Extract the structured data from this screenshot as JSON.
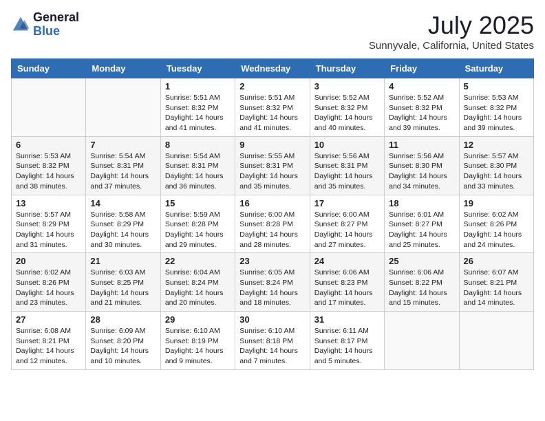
{
  "header": {
    "logo_general": "General",
    "logo_blue": "Blue",
    "month": "July 2025",
    "location": "Sunnyvale, California, United States"
  },
  "weekdays": [
    "Sunday",
    "Monday",
    "Tuesday",
    "Wednesday",
    "Thursday",
    "Friday",
    "Saturday"
  ],
  "weeks": [
    [
      {
        "day": "",
        "info": ""
      },
      {
        "day": "",
        "info": ""
      },
      {
        "day": "1",
        "info": "Sunrise: 5:51 AM\nSunset: 8:32 PM\nDaylight: 14 hours and 41 minutes."
      },
      {
        "day": "2",
        "info": "Sunrise: 5:51 AM\nSunset: 8:32 PM\nDaylight: 14 hours and 41 minutes."
      },
      {
        "day": "3",
        "info": "Sunrise: 5:52 AM\nSunset: 8:32 PM\nDaylight: 14 hours and 40 minutes."
      },
      {
        "day": "4",
        "info": "Sunrise: 5:52 AM\nSunset: 8:32 PM\nDaylight: 14 hours and 39 minutes."
      },
      {
        "day": "5",
        "info": "Sunrise: 5:53 AM\nSunset: 8:32 PM\nDaylight: 14 hours and 39 minutes."
      }
    ],
    [
      {
        "day": "6",
        "info": "Sunrise: 5:53 AM\nSunset: 8:32 PM\nDaylight: 14 hours and 38 minutes."
      },
      {
        "day": "7",
        "info": "Sunrise: 5:54 AM\nSunset: 8:31 PM\nDaylight: 14 hours and 37 minutes."
      },
      {
        "day": "8",
        "info": "Sunrise: 5:54 AM\nSunset: 8:31 PM\nDaylight: 14 hours and 36 minutes."
      },
      {
        "day": "9",
        "info": "Sunrise: 5:55 AM\nSunset: 8:31 PM\nDaylight: 14 hours and 35 minutes."
      },
      {
        "day": "10",
        "info": "Sunrise: 5:56 AM\nSunset: 8:31 PM\nDaylight: 14 hours and 35 minutes."
      },
      {
        "day": "11",
        "info": "Sunrise: 5:56 AM\nSunset: 8:30 PM\nDaylight: 14 hours and 34 minutes."
      },
      {
        "day": "12",
        "info": "Sunrise: 5:57 AM\nSunset: 8:30 PM\nDaylight: 14 hours and 33 minutes."
      }
    ],
    [
      {
        "day": "13",
        "info": "Sunrise: 5:57 AM\nSunset: 8:29 PM\nDaylight: 14 hours and 31 minutes."
      },
      {
        "day": "14",
        "info": "Sunrise: 5:58 AM\nSunset: 8:29 PM\nDaylight: 14 hours and 30 minutes."
      },
      {
        "day": "15",
        "info": "Sunrise: 5:59 AM\nSunset: 8:28 PM\nDaylight: 14 hours and 29 minutes."
      },
      {
        "day": "16",
        "info": "Sunrise: 6:00 AM\nSunset: 8:28 PM\nDaylight: 14 hours and 28 minutes."
      },
      {
        "day": "17",
        "info": "Sunrise: 6:00 AM\nSunset: 8:27 PM\nDaylight: 14 hours and 27 minutes."
      },
      {
        "day": "18",
        "info": "Sunrise: 6:01 AM\nSunset: 8:27 PM\nDaylight: 14 hours and 25 minutes."
      },
      {
        "day": "19",
        "info": "Sunrise: 6:02 AM\nSunset: 8:26 PM\nDaylight: 14 hours and 24 minutes."
      }
    ],
    [
      {
        "day": "20",
        "info": "Sunrise: 6:02 AM\nSunset: 8:26 PM\nDaylight: 14 hours and 23 minutes."
      },
      {
        "day": "21",
        "info": "Sunrise: 6:03 AM\nSunset: 8:25 PM\nDaylight: 14 hours and 21 minutes."
      },
      {
        "day": "22",
        "info": "Sunrise: 6:04 AM\nSunset: 8:24 PM\nDaylight: 14 hours and 20 minutes."
      },
      {
        "day": "23",
        "info": "Sunrise: 6:05 AM\nSunset: 8:24 PM\nDaylight: 14 hours and 18 minutes."
      },
      {
        "day": "24",
        "info": "Sunrise: 6:06 AM\nSunset: 8:23 PM\nDaylight: 14 hours and 17 minutes."
      },
      {
        "day": "25",
        "info": "Sunrise: 6:06 AM\nSunset: 8:22 PM\nDaylight: 14 hours and 15 minutes."
      },
      {
        "day": "26",
        "info": "Sunrise: 6:07 AM\nSunset: 8:21 PM\nDaylight: 14 hours and 14 minutes."
      }
    ],
    [
      {
        "day": "27",
        "info": "Sunrise: 6:08 AM\nSunset: 8:21 PM\nDaylight: 14 hours and 12 minutes."
      },
      {
        "day": "28",
        "info": "Sunrise: 6:09 AM\nSunset: 8:20 PM\nDaylight: 14 hours and 10 minutes."
      },
      {
        "day": "29",
        "info": "Sunrise: 6:10 AM\nSunset: 8:19 PM\nDaylight: 14 hours and 9 minutes."
      },
      {
        "day": "30",
        "info": "Sunrise: 6:10 AM\nSunset: 8:18 PM\nDaylight: 14 hours and 7 minutes."
      },
      {
        "day": "31",
        "info": "Sunrise: 6:11 AM\nSunset: 8:17 PM\nDaylight: 14 hours and 5 minutes."
      },
      {
        "day": "",
        "info": ""
      },
      {
        "day": "",
        "info": ""
      }
    ]
  ]
}
